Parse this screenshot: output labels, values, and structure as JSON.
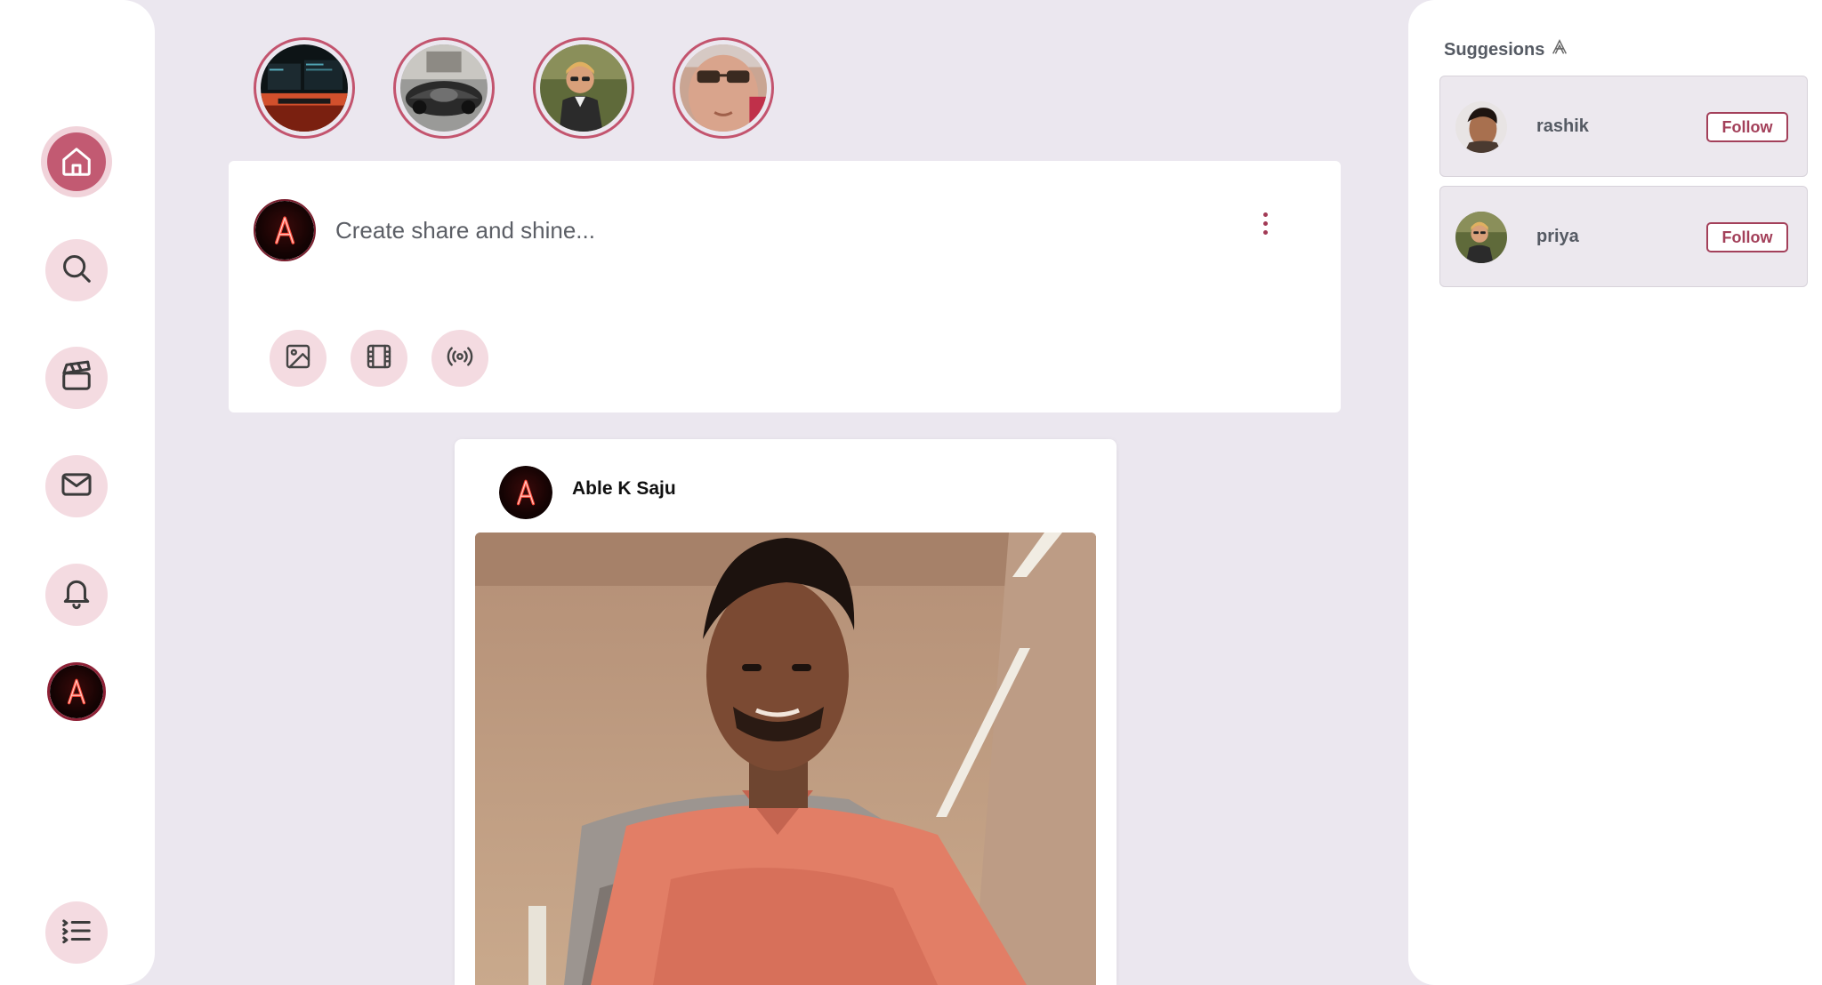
{
  "nav": {
    "items": [
      {
        "id": "home",
        "icon": "home-icon",
        "active": true
      },
      {
        "id": "search",
        "icon": "search-icon"
      },
      {
        "id": "reels",
        "icon": "clapperboard-icon"
      },
      {
        "id": "messages",
        "icon": "mail-icon"
      },
      {
        "id": "notifications",
        "icon": "bell-icon"
      },
      {
        "id": "profile",
        "icon": "profile-avatar"
      },
      {
        "id": "menu",
        "icon": "menu-list-icon"
      }
    ]
  },
  "stories": [
    {
      "id": "story-1",
      "subject": "desk-setup"
    },
    {
      "id": "story-2",
      "subject": "sports-car"
    },
    {
      "id": "story-3",
      "subject": "person-sunglasses"
    },
    {
      "id": "story-4",
      "subject": "face-closeup"
    }
  ],
  "composer": {
    "placeholder": "Create share and shine...",
    "actions": [
      "image-icon",
      "film-icon",
      "broadcast-icon"
    ]
  },
  "post": {
    "author": "Able K Saju"
  },
  "suggestions": {
    "title": "Suggesions",
    "users": [
      {
        "name": "rashik",
        "follow_label": "Follow"
      },
      {
        "name": "priya",
        "follow_label": "Follow"
      }
    ]
  },
  "colors": {
    "accent": "#c25a72",
    "accent_soft": "#f4dbe1",
    "page_bg": "#ebe7ef",
    "follow": "#a3405a"
  }
}
